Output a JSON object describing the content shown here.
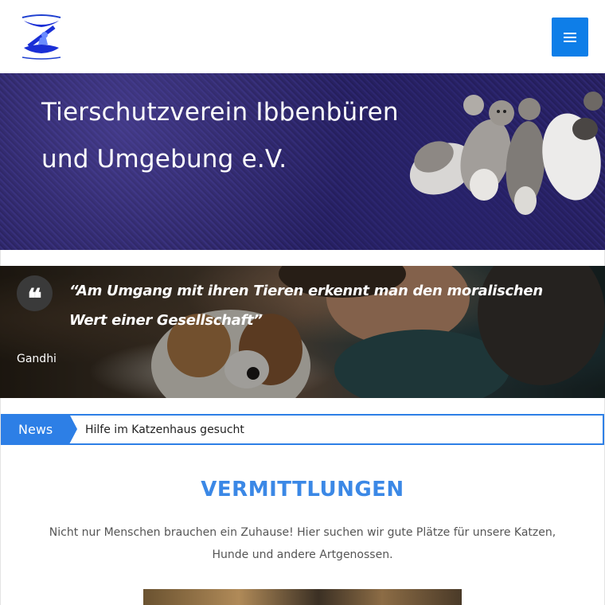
{
  "header": {
    "logo_icon": "tierschutzverein-logo-icon",
    "menu_icon": "hamburger-menu-icon",
    "accent_color": "#0e7ee8"
  },
  "hero": {
    "title_line1": "Tierschutzverein Ibbenbüren",
    "title_line2": "und Umgebung e.V."
  },
  "quote": {
    "icon": "quote-icon",
    "text": "“Am Umgang mit ihren Tieren erkennt man den moralischen Wert einer Gesellschaft”",
    "author": "Gandhi"
  },
  "news": {
    "label": "News",
    "headline": "Hilfe im Katzenhaus gesucht",
    "color": "#2d7fe6"
  },
  "section": {
    "title": "VERMITTLUNGEN",
    "description": "Nicht nur Menschen brauchen ein Zuhause! Hier suchen wir gute Plätze für unsere Katzen, Hunde und andere Artgenossen.",
    "title_color": "#3b88e6"
  }
}
